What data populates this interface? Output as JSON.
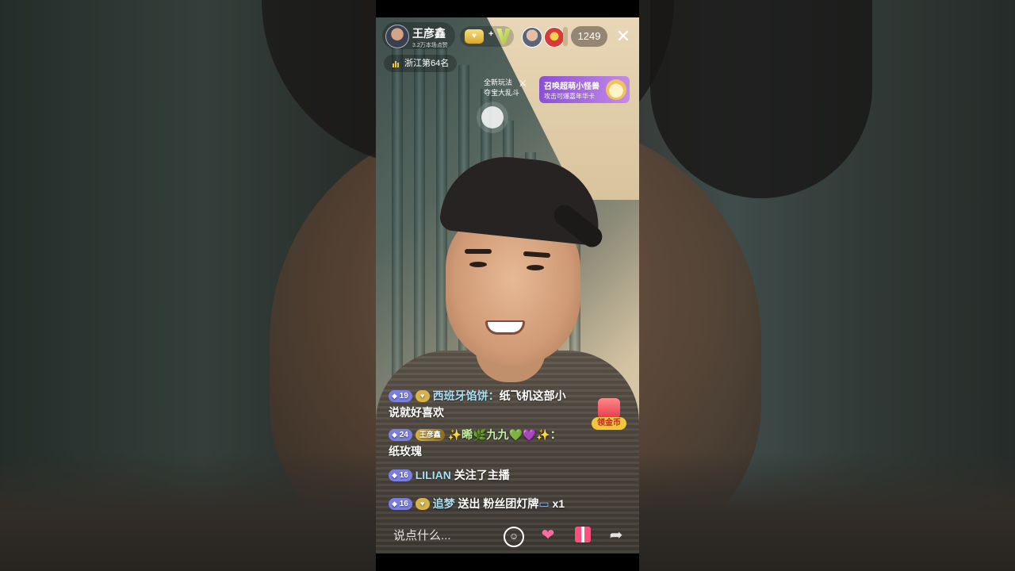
{
  "host": {
    "name": "王彦鑫",
    "likes": "3.2万本场点赞",
    "rank": "浙江第64名"
  },
  "top_bar": {
    "badge_gold_label": "",
    "badge_plus": "+",
    "viewer_count": "1249",
    "close": "✕"
  },
  "game_entry": {
    "line1": "全新玩法",
    "line2": "夺宝大乱斗"
  },
  "event_banner": {
    "title": "召唤超萌小怪兽",
    "subtitle": "攻击可爆嘉年华卡"
  },
  "comments": [
    {
      "level": "19",
      "user": "西班牙馅饼：",
      "text_inline": "纸飞机这部小",
      "text_wrap": "说就好喜欢"
    },
    {
      "level": "24",
      "fan_badge": "王彦鑫",
      "user": "✨晞🌿九九💚💜✨：",
      "text_wrap": "纸玫瑰"
    },
    {
      "level": "16",
      "user": "LILIAN",
      "text_inline": " 关注了主播"
    },
    {
      "level": "16",
      "user": "追梦",
      "text_inline": " 送出 粉丝团灯牌",
      "suffix": " x1"
    }
  ],
  "coin_reward": {
    "label": "领金币"
  },
  "input": {
    "placeholder": "说点什么..."
  },
  "icons": {
    "emoji": "emoji-icon",
    "heart": "heart-icon",
    "gift": "gift-icon",
    "share": "share-icon"
  }
}
